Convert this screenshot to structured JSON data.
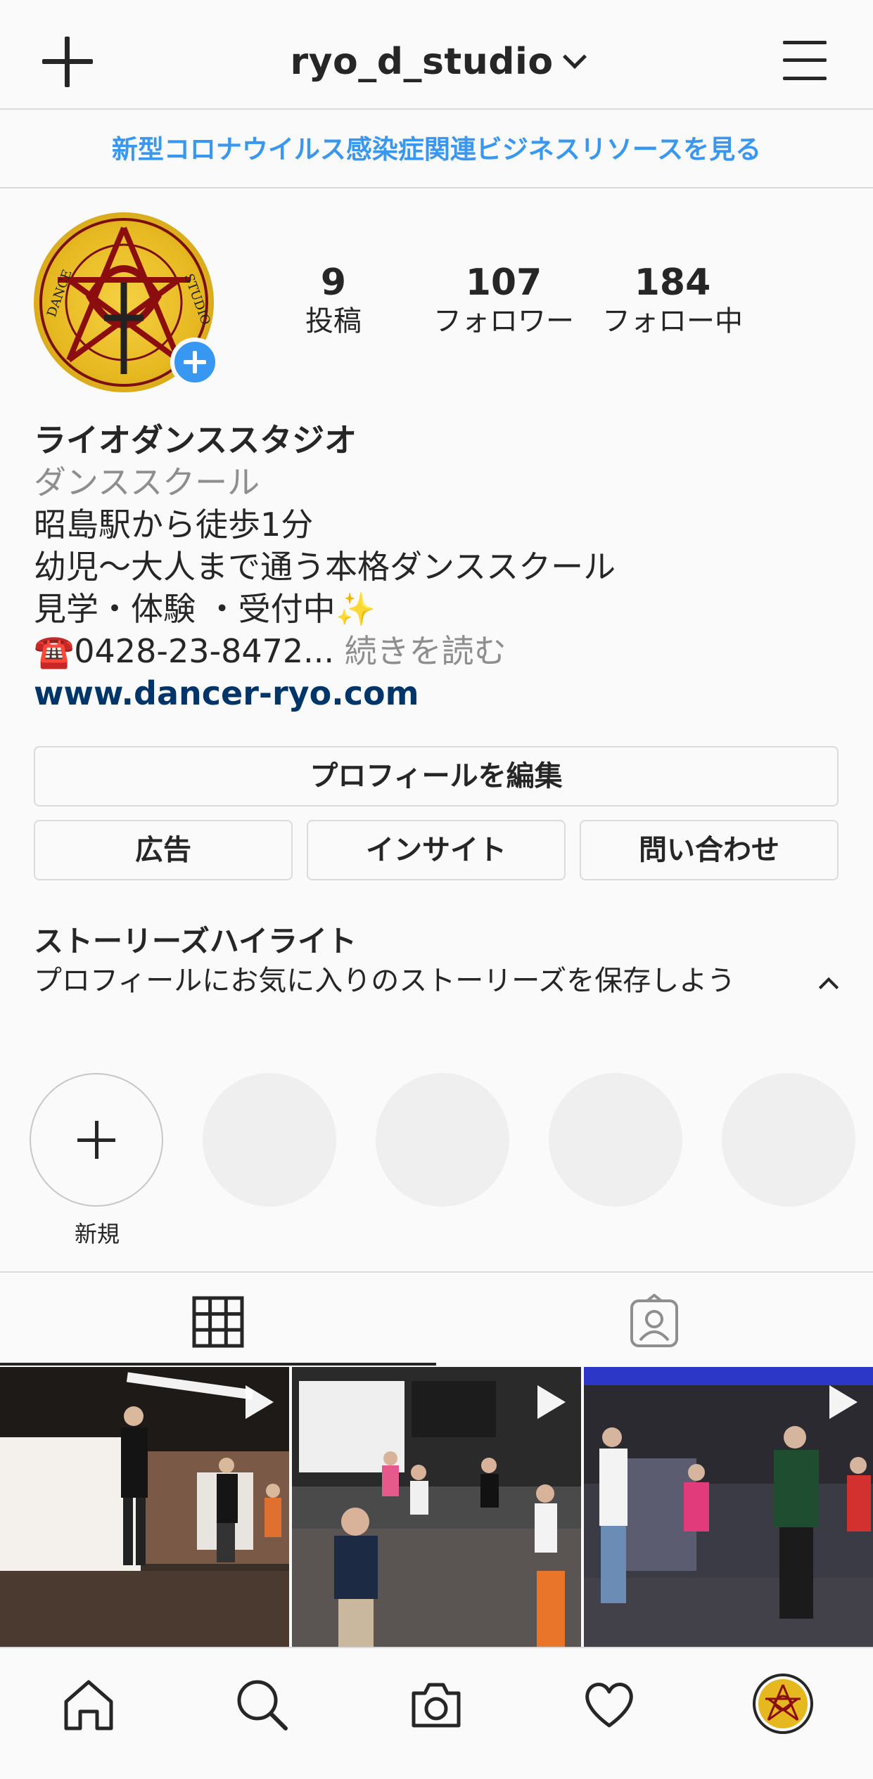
{
  "header": {
    "username": "ryo_d_studio"
  },
  "banner": {
    "text": "新型コロナウイルス感染症関連ビジネスリソースを見る"
  },
  "stats": [
    {
      "value": "9",
      "label": "投稿"
    },
    {
      "value": "107",
      "label": "フォロワー"
    },
    {
      "value": "184",
      "label": "フォロー中"
    }
  ],
  "bio": {
    "name": "ライオダンススタジオ",
    "category": "ダンススクール",
    "line1": "昭島駅から徒歩1分",
    "line2": "幼児〜大人まで通う本格ダンススクール",
    "line3": "見学・体験 ・受付中✨",
    "line4": "☎️0428-23-8472...",
    "more": "続きを読む",
    "link": "www.dancer-ryo.com"
  },
  "buttons": {
    "edit_profile": "プロフィールを編集",
    "ads": "広告",
    "insights": "インサイト",
    "contact": "問い合わせ"
  },
  "highlights": {
    "title": "ストーリーズハイライト",
    "subtitle": "プロフィールにお気に入りのストーリーズを保存しよう",
    "new_label": "新規"
  },
  "colors": {
    "accent": "#3897f0",
    "link": "#003569",
    "text": "#262626",
    "muted": "#8e8e8e",
    "border": "#dbdbdb"
  }
}
